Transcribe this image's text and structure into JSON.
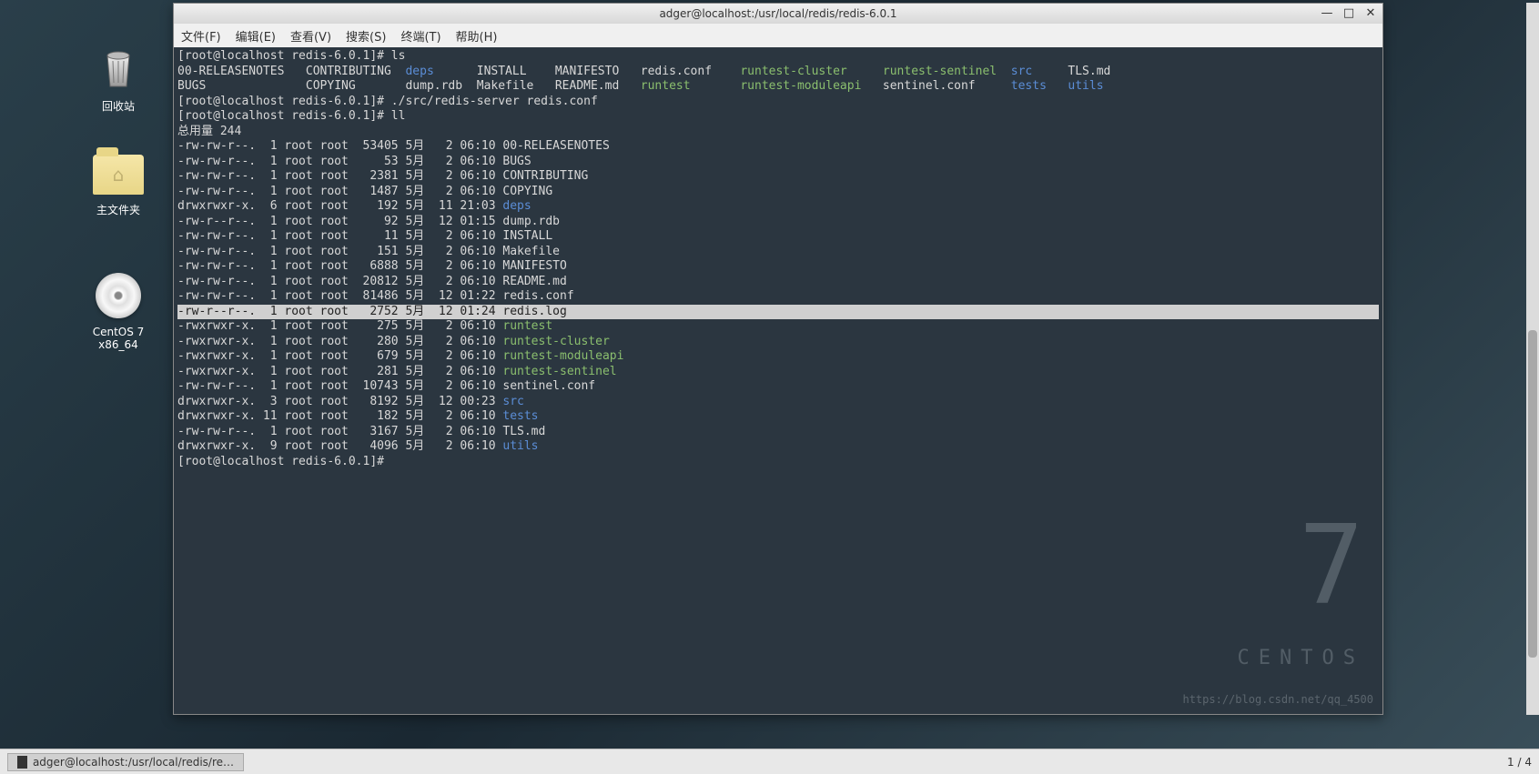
{
  "desktop": {
    "trash_label": "回收站",
    "home_label": "主文件夹",
    "cd_label": "CentOS 7 x86_64"
  },
  "window": {
    "title": "adger@localhost:/usr/local/redis/redis-6.0.1",
    "menu": {
      "file": "文件(F)",
      "edit": "编辑(E)",
      "view": "查看(V)",
      "search": "搜索(S)",
      "terminal": "终端(T)",
      "help": "帮助(H)"
    },
    "win_min": "—",
    "win_max": "□",
    "win_close": "✕"
  },
  "terminal": {
    "prompt": "[root@localhost redis-6.0.1]# ",
    "cmd_ls": "ls",
    "cmd_server": "./src/redis-server redis.conf",
    "cmd_ll": "ll",
    "total": "总用量 244",
    "ls_row1": {
      "c1": "00-RELEASENOTES",
      "c2": "CONTRIBUTING",
      "c3": "deps",
      "c4": "INSTALL",
      "c5": "MANIFESTO",
      "c6": "redis.conf",
      "c7": "runtest-cluster",
      "c8": "runtest-sentinel",
      "c9": "src",
      "c10": "TLS.md"
    },
    "ls_row2": {
      "c1": "BUGS",
      "c2": "COPYING",
      "c3": "dump.rdb",
      "c4": "Makefile",
      "c5": "README.md",
      "c6": "runtest",
      "c7": "runtest-moduleapi",
      "c8": "sentinel.conf",
      "c9": "tests",
      "c10": "utils"
    },
    "ll": [
      {
        "perm": "-rw-rw-r--.",
        "n": " 1",
        "u": "root",
        "g": "root",
        "size": " 53405",
        "mon": "5月",
        "day": "  2",
        "time": "06:10",
        "name": "00-RELEASENOTES",
        "color": "c-white"
      },
      {
        "perm": "-rw-rw-r--.",
        "n": " 1",
        "u": "root",
        "g": "root",
        "size": "    53",
        "mon": "5月",
        "day": "  2",
        "time": "06:10",
        "name": "BUGS",
        "color": "c-white"
      },
      {
        "perm": "-rw-rw-r--.",
        "n": " 1",
        "u": "root",
        "g": "root",
        "size": "  2381",
        "mon": "5月",
        "day": "  2",
        "time": "06:10",
        "name": "CONTRIBUTING",
        "color": "c-white"
      },
      {
        "perm": "-rw-rw-r--.",
        "n": " 1",
        "u": "root",
        "g": "root",
        "size": "  1487",
        "mon": "5月",
        "day": "  2",
        "time": "06:10",
        "name": "COPYING",
        "color": "c-white"
      },
      {
        "perm": "drwxrwxr-x.",
        "n": " 6",
        "u": "root",
        "g": "root",
        "size": "   192",
        "mon": "5月",
        "day": " 11",
        "time": "21:03",
        "name": "deps",
        "color": "c-blue"
      },
      {
        "perm": "-rw-r--r--.",
        "n": " 1",
        "u": "root",
        "g": "root",
        "size": "    92",
        "mon": "5月",
        "day": " 12",
        "time": "01:15",
        "name": "dump.rdb",
        "color": "c-white"
      },
      {
        "perm": "-rw-rw-r--.",
        "n": " 1",
        "u": "root",
        "g": "root",
        "size": "    11",
        "mon": "5月",
        "day": "  2",
        "time": "06:10",
        "name": "INSTALL",
        "color": "c-white"
      },
      {
        "perm": "-rw-rw-r--.",
        "n": " 1",
        "u": "root",
        "g": "root",
        "size": "   151",
        "mon": "5月",
        "day": "  2",
        "time": "06:10",
        "name": "Makefile",
        "color": "c-white"
      },
      {
        "perm": "-rw-rw-r--.",
        "n": " 1",
        "u": "root",
        "g": "root",
        "size": "  6888",
        "mon": "5月",
        "day": "  2",
        "time": "06:10",
        "name": "MANIFESTO",
        "color": "c-white"
      },
      {
        "perm": "-rw-rw-r--.",
        "n": " 1",
        "u": "root",
        "g": "root",
        "size": " 20812",
        "mon": "5月",
        "day": "  2",
        "time": "06:10",
        "name": "README.md",
        "color": "c-white"
      },
      {
        "perm": "-rw-rw-r--.",
        "n": " 1",
        "u": "root",
        "g": "root",
        "size": " 81486",
        "mon": "5月",
        "day": " 12",
        "time": "01:22",
        "name": "redis.conf",
        "color": "c-white"
      },
      {
        "perm": "-rw-r--r--.",
        "n": " 1",
        "u": "root",
        "g": "root",
        "size": "  2752",
        "mon": "5月",
        "day": " 12",
        "time": "01:24",
        "name": "redis.log",
        "color": "c-white",
        "sel": true
      },
      {
        "perm": "-rwxrwxr-x.",
        "n": " 1",
        "u": "root",
        "g": "root",
        "size": "   275",
        "mon": "5月",
        "day": "  2",
        "time": "06:10",
        "name": "runtest",
        "color": "c-green"
      },
      {
        "perm": "-rwxrwxr-x.",
        "n": " 1",
        "u": "root",
        "g": "root",
        "size": "   280",
        "mon": "5月",
        "day": "  2",
        "time": "06:10",
        "name": "runtest-cluster",
        "color": "c-green"
      },
      {
        "perm": "-rwxrwxr-x.",
        "n": " 1",
        "u": "root",
        "g": "root",
        "size": "   679",
        "mon": "5月",
        "day": "  2",
        "time": "06:10",
        "name": "runtest-moduleapi",
        "color": "c-green"
      },
      {
        "perm": "-rwxrwxr-x.",
        "n": " 1",
        "u": "root",
        "g": "root",
        "size": "   281",
        "mon": "5月",
        "day": "  2",
        "time": "06:10",
        "name": "runtest-sentinel",
        "color": "c-green"
      },
      {
        "perm": "-rw-rw-r--.",
        "n": " 1",
        "u": "root",
        "g": "root",
        "size": " 10743",
        "mon": "5月",
        "day": "  2",
        "time": "06:10",
        "name": "sentinel.conf",
        "color": "c-white"
      },
      {
        "perm": "drwxrwxr-x.",
        "n": " 3",
        "u": "root",
        "g": "root",
        "size": "  8192",
        "mon": "5月",
        "day": " 12",
        "time": "00:23",
        "name": "src",
        "color": "c-blue"
      },
      {
        "perm": "drwxrwxr-x.",
        "n": "11",
        "u": "root",
        "g": "root",
        "size": "   182",
        "mon": "5月",
        "day": "  2",
        "time": "06:10",
        "name": "tests",
        "color": "c-blue"
      },
      {
        "perm": "-rw-rw-r--.",
        "n": " 1",
        "u": "root",
        "g": "root",
        "size": "  3167",
        "mon": "5月",
        "day": "  2",
        "time": "06:10",
        "name": "TLS.md",
        "color": "c-white"
      },
      {
        "perm": "drwxrwxr-x.",
        "n": " 9",
        "u": "root",
        "g": "root",
        "size": "  4096",
        "mon": "5月",
        "day": "  2",
        "time": "06:10",
        "name": "utils",
        "color": "c-blue"
      }
    ]
  },
  "centos": {
    "seven": "7",
    "label": "CENTOS"
  },
  "watermark": "https://blog.csdn.net/qq_4500",
  "taskbar": {
    "task1": "adger@localhost:/usr/local/redis/re…",
    "pager": "1 / 4"
  }
}
